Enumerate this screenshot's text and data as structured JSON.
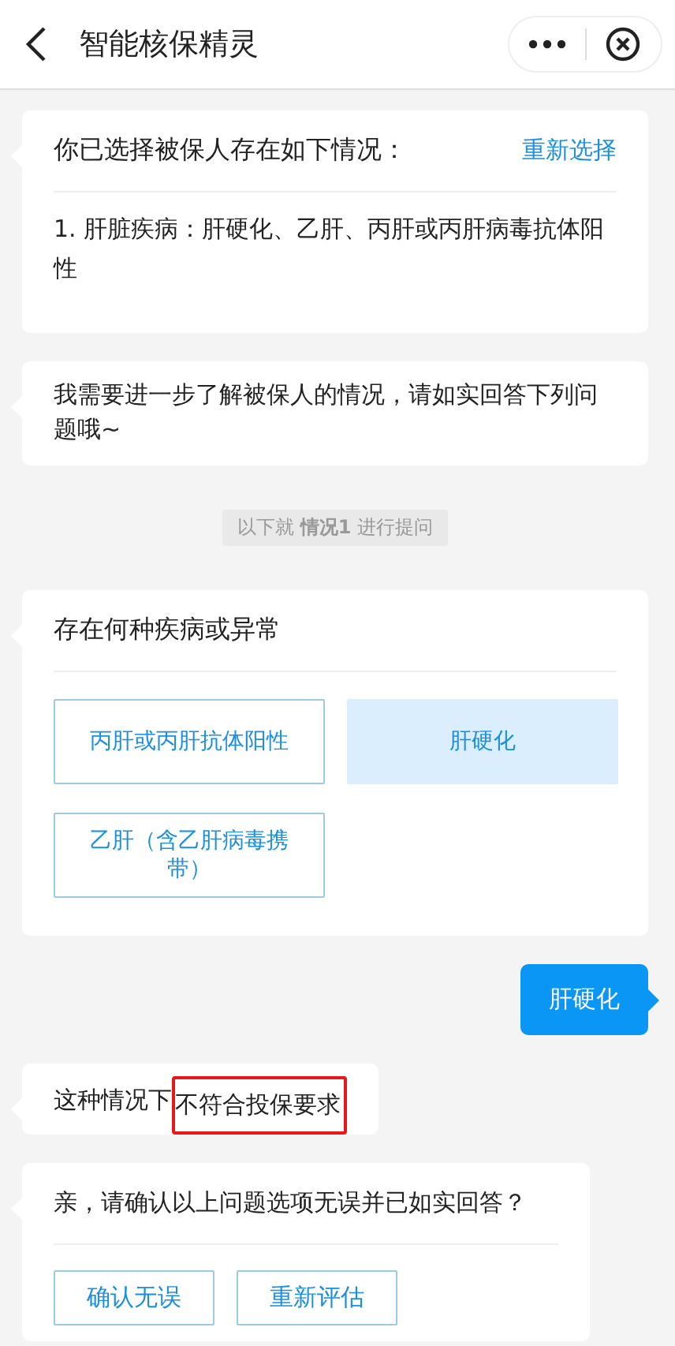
{
  "header": {
    "title": "智能核保精灵"
  },
  "messages": [
    {
      "kind": "selection",
      "title": "你已选择被保人存在如下情况：",
      "action": "重新选择",
      "items": [
        "1.  肝脏疾病：肝硬化、乙肝、丙肝或丙肝病毒抗体阳性"
      ]
    },
    {
      "kind": "text",
      "text": "我需要进一步了解被保人的情况，请如实回答下列问题哦~"
    },
    {
      "kind": "note",
      "text": "以下就 **情况1** 进行提问"
    },
    {
      "kind": "question",
      "title": "存在何种疾病或异常",
      "options": [
        {
          "label": "丙肝或丙肝抗体阳性",
          "selected": false
        },
        {
          "label": "肝硬化",
          "selected": true
        },
        {
          "label": "乙肝（含乙肝病毒携带）",
          "selected": false
        }
      ]
    },
    {
      "kind": "reply",
      "text": "肝硬化"
    },
    {
      "kind": "result",
      "text": "这种情况下",
      "highlight": "不符合投保要求"
    },
    {
      "kind": "confirm",
      "title": "亲，请确认以上问题选项无误并已如实回答？",
      "buttons": [
        "确认无误",
        "重新评估"
      ]
    }
  ]
}
